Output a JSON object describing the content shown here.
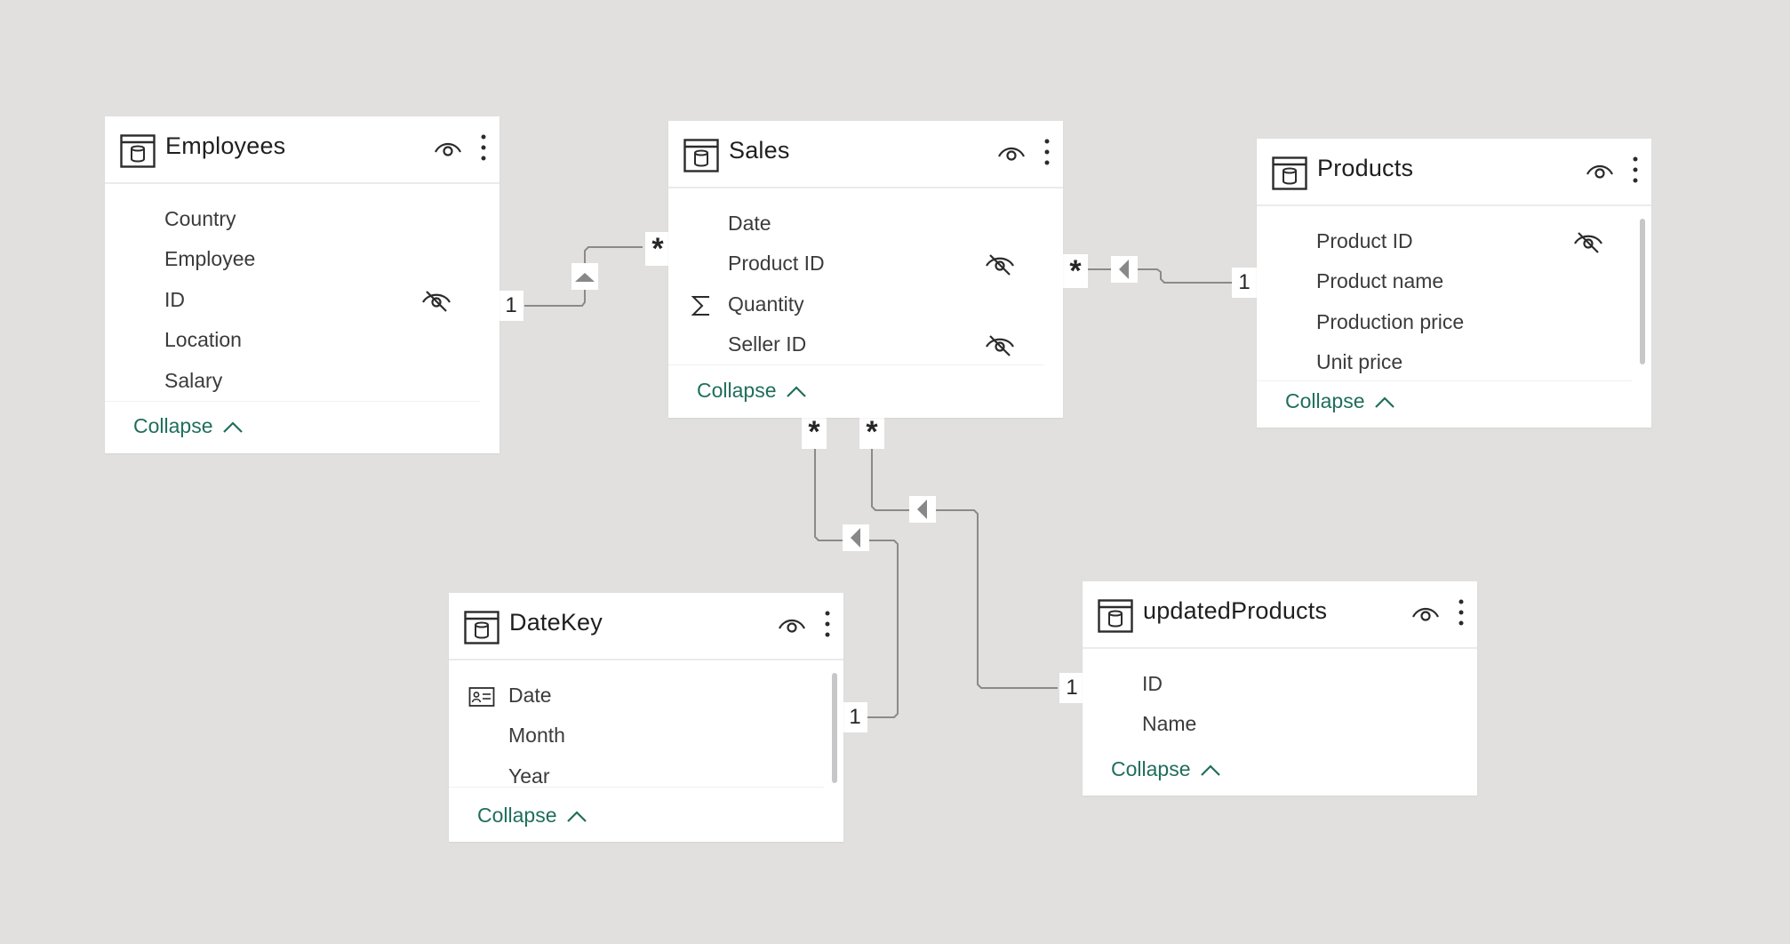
{
  "colors": {
    "background": "#e1e0df",
    "card": "#ffffff",
    "link": "#1f6e5c",
    "line": "#8a8a8a",
    "arrow": "#888888",
    "text": "#3b3b3b"
  },
  "tables": {
    "employees": {
      "title": "Employees",
      "fields": [
        {
          "label": "Country"
        },
        {
          "label": "Employee"
        },
        {
          "label": "ID",
          "hidden": true
        },
        {
          "label": "Location"
        },
        {
          "label": "Salary"
        }
      ],
      "collapse": "Collapse"
    },
    "sales": {
      "title": "Sales",
      "fields": [
        {
          "label": "Date"
        },
        {
          "label": "Product ID",
          "hidden": true
        },
        {
          "label": "Quantity",
          "icon": "sigma-icon"
        },
        {
          "label": "Seller ID",
          "hidden": true
        }
      ],
      "collapse": "Collapse"
    },
    "products": {
      "title": "Products",
      "fields": [
        {
          "label": "Product ID",
          "hidden": true
        },
        {
          "label": "Product name"
        },
        {
          "label": "Production price"
        },
        {
          "label": "Unit price"
        }
      ],
      "collapse": "Collapse"
    },
    "datekey": {
      "title": "DateKey",
      "fields": [
        {
          "label": "Date",
          "icon": "id-card-icon"
        },
        {
          "label": "Month"
        },
        {
          "label": "Year"
        }
      ],
      "collapse": "Collapse"
    },
    "updated_products": {
      "title": "updatedProducts",
      "fields": [
        {
          "label": "ID"
        },
        {
          "label": "Name"
        }
      ],
      "collapse": "Collapse"
    }
  },
  "relationships": {
    "employees_sales": {
      "from_card": "1",
      "to_card": "*",
      "direction": "up"
    },
    "products_sales": {
      "from_card": "1",
      "to_card": "*",
      "direction": "left"
    },
    "datekey_sales": {
      "from_card": "1",
      "to_card": "*",
      "direction": "left"
    },
    "updated_sales": {
      "from_card": "1",
      "to_card": "*",
      "direction": "left"
    }
  }
}
